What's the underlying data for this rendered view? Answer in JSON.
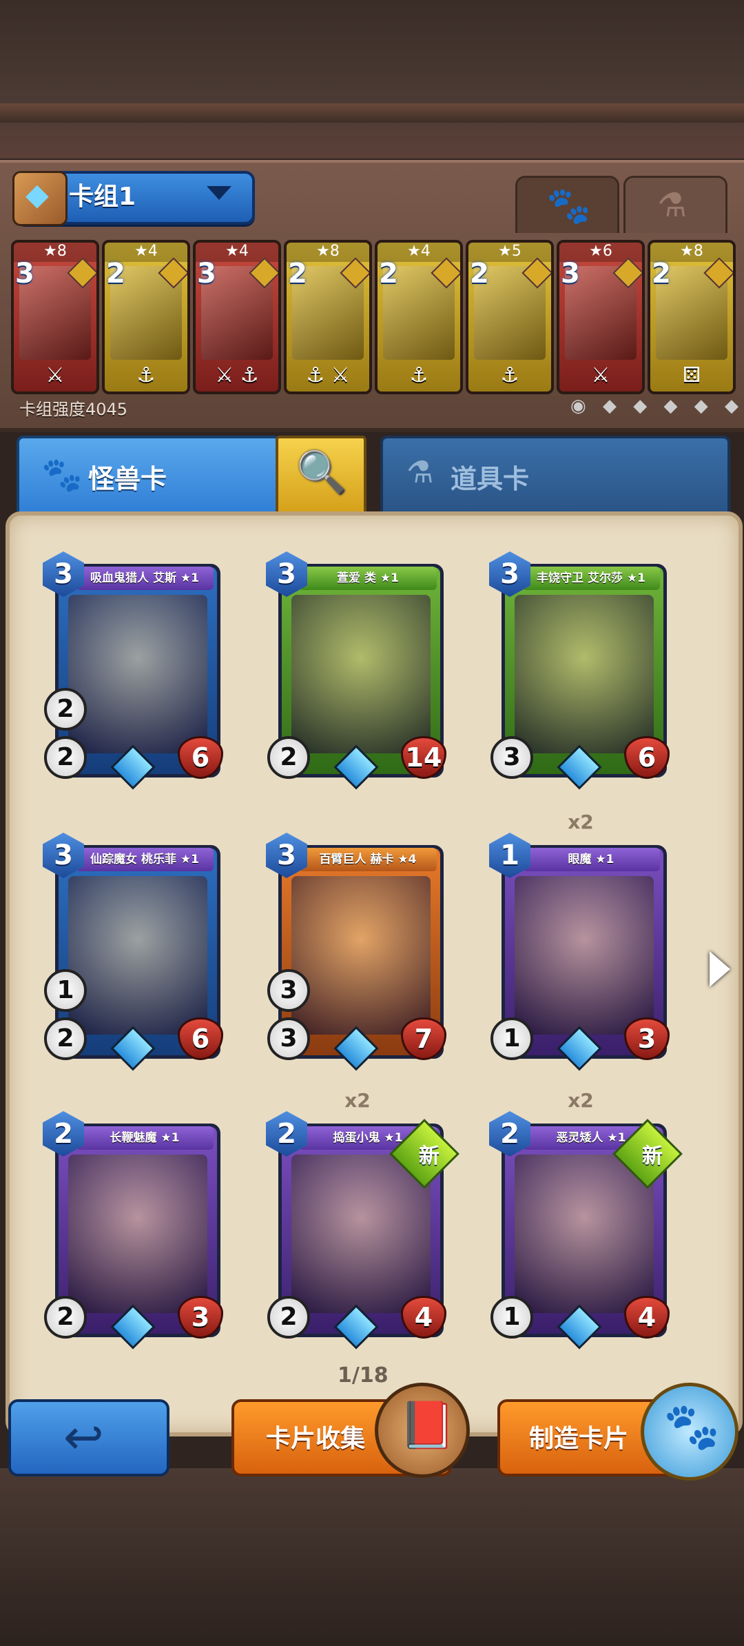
{
  "deck": {
    "name": "卡组1",
    "power_label": "卡组强度4045",
    "filter_icons": "◉ ◆ ◆ ◆ ◆ ◆",
    "slots": [
      {
        "stars": "★8",
        "cost": "3",
        "tags": "⚔",
        "color": "red"
      },
      {
        "stars": "★4",
        "cost": "2",
        "tags": "⚓",
        "color": "yellow"
      },
      {
        "stars": "★4",
        "cost": "3",
        "tags": "⚔ ⚓",
        "color": "red"
      },
      {
        "stars": "★8",
        "cost": "2",
        "tags": "⚓ ⚔",
        "color": "yellow"
      },
      {
        "stars": "★4",
        "cost": "2",
        "tags": "⚓",
        "color": "yellow"
      },
      {
        "stars": "★5",
        "cost": "2",
        "tags": "⚓",
        "color": "yellow"
      },
      {
        "stars": "★6",
        "cost": "3",
        "tags": "⚔",
        "color": "red"
      },
      {
        "stars": "★8",
        "cost": "2",
        "tags": "⚄",
        "color": "yellow"
      }
    ]
  },
  "tabs": {
    "monster_icon": "🐾",
    "potion_icon": "⚗"
  },
  "categories": {
    "monster": "怪兽卡",
    "item": "道具卡",
    "search_icon": "🔍"
  },
  "cards": [
    {
      "name": "吸血鬼猎人 艾斯 ★1",
      "cost": "3",
      "atk": "2",
      "def": "2",
      "hp": "6",
      "frame": "blue",
      "copies": "",
      "new": false
    },
    {
      "name": "萱爱 类 ★1",
      "cost": "3",
      "atk": "2",
      "def": "",
      "hp": "14",
      "frame": "green",
      "copies": "",
      "new": false
    },
    {
      "name": "丰饶守卫 艾尔莎 ★1",
      "cost": "3",
      "atk": "3",
      "def": "",
      "hp": "6",
      "frame": "green",
      "copies": "",
      "new": false
    },
    {
      "name": "仙踪魔女 桃乐菲 ★1",
      "cost": "3",
      "atk": "2",
      "def": "1",
      "hp": "6",
      "frame": "blue",
      "copies": "",
      "new": false
    },
    {
      "name": "百臂巨人 赫卡 ★4",
      "cost": "3",
      "atk": "3",
      "def": "3",
      "hp": "7",
      "frame": "orange",
      "copies": "",
      "new": false
    },
    {
      "name": "眼魔 ★1",
      "cost": "1",
      "atk": "1",
      "def": "",
      "hp": "3",
      "frame": "purple",
      "copies": "x2",
      "new": false
    },
    {
      "name": "长鞭魅魔 ★1",
      "cost": "2",
      "atk": "2",
      "def": "",
      "hp": "3",
      "frame": "purple",
      "copies": "",
      "new": false
    },
    {
      "name": "捣蛋小鬼 ★1",
      "cost": "2",
      "atk": "2",
      "def": "",
      "hp": "4",
      "frame": "purple",
      "copies": "x2",
      "new": true
    },
    {
      "name": "恶灵矮人 ★1",
      "cost": "2",
      "atk": "1",
      "def": "",
      "hp": "4",
      "frame": "purple",
      "copies": "x2",
      "new": true
    }
  ],
  "new_badge": "新",
  "page_indicator": "1/18",
  "buttons": {
    "back_icon": "↩",
    "collect": "卡片收集",
    "collect_icon": "📕",
    "craft": "制造卡片",
    "craft_icon": "🐾"
  }
}
